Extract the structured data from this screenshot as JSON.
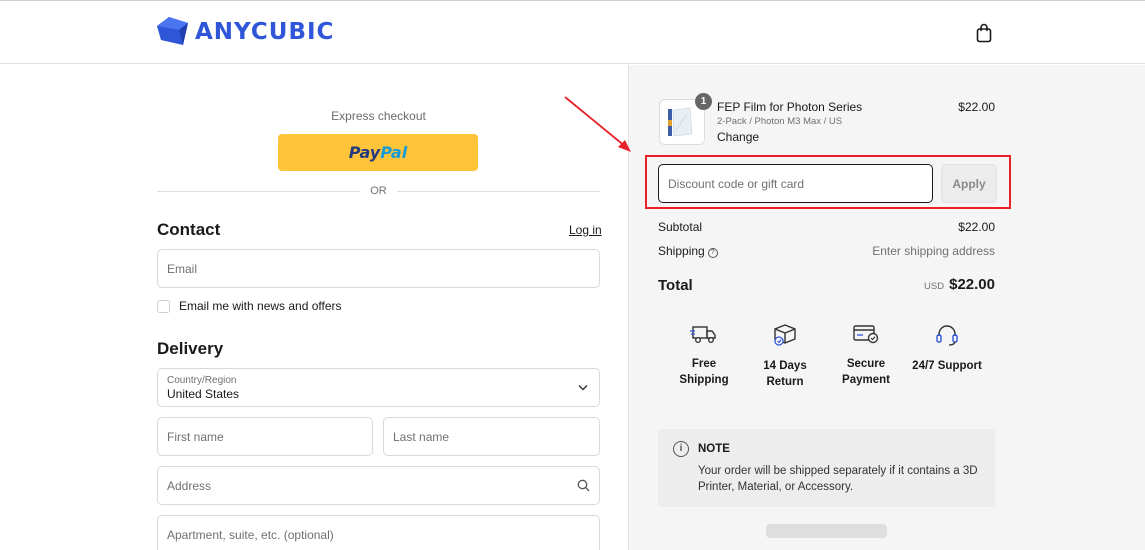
{
  "brand": {
    "name": "ANYCUBIC"
  },
  "header": {
    "bag_icon": "shopping-bag-icon"
  },
  "express": {
    "label": "Express checkout",
    "paypal_part1": "Pay",
    "paypal_part2": "Pal",
    "divider": "OR"
  },
  "contact": {
    "title": "Contact",
    "login": "Log in",
    "email_placeholder": "Email",
    "newsletter": "Email me with news and offers"
  },
  "delivery": {
    "title": "Delivery",
    "country_label": "Country/Region",
    "country_value": "United States",
    "first_name": "First name",
    "last_name": "Last name",
    "address": "Address",
    "apartment": "Apartment, suite, etc. (optional)"
  },
  "order": {
    "item": {
      "name": "FEP Film for Photon Series",
      "variant": "2-Pack / Photon M3 Max / US",
      "change": "Change",
      "price": "$22.00",
      "quantity": "1"
    },
    "discount_placeholder": "Discount code or gift card",
    "apply": "Apply",
    "subtotal_label": "Subtotal",
    "subtotal_value": "$22.00",
    "shipping_label": "Shipping",
    "shipping_value": "Enter shipping address",
    "total_label": "Total",
    "total_currency": "USD",
    "total_value": "$22.00"
  },
  "features": [
    {
      "line1": "Free",
      "line2": "Shipping",
      "icon": "truck-icon"
    },
    {
      "line1": "14 Days",
      "line2": "Return",
      "icon": "return-box-icon"
    },
    {
      "line1": "Secure",
      "line2": "Payment",
      "icon": "secure-card-icon"
    },
    {
      "line1": "24/7 Support",
      "line2": "",
      "icon": "headset-icon"
    }
  ],
  "note": {
    "title": "NOTE",
    "text": "Your order will be shipped separately if it contains a 3D Printer, Material, or Accessory."
  },
  "colors": {
    "brand": "#2f56d8",
    "paypal": "#ffc439",
    "highlight": "#e8202a"
  }
}
